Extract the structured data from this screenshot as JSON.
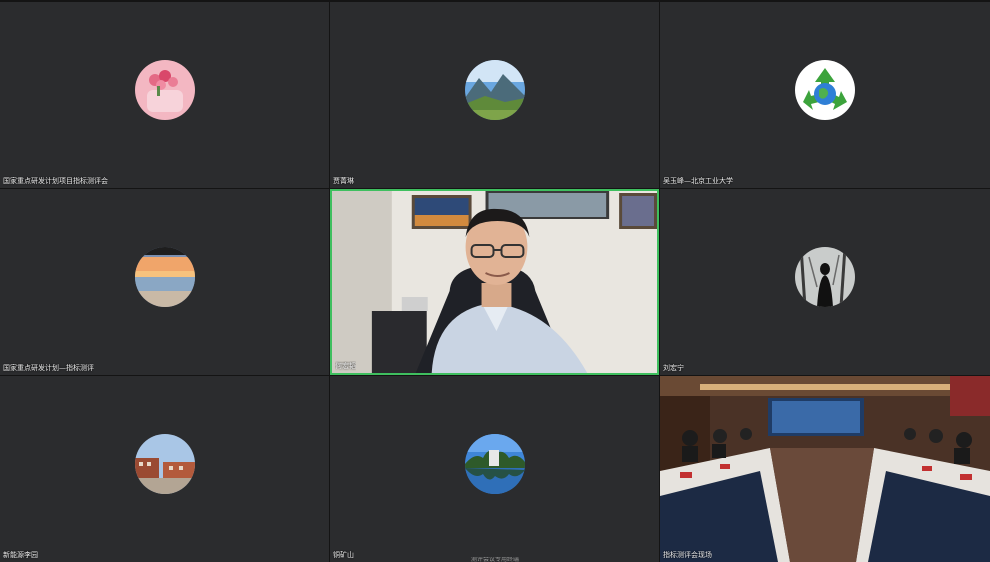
{
  "participants": [
    {
      "name": "国家重点研发计划项目指标测评会",
      "avatar_icon": "rose-flowers-icon"
    },
    {
      "name": "贾菁琳",
      "avatar_icon": "mountain-landscape-icon"
    },
    {
      "name": "吴玉峰—北京工业大学",
      "avatar_icon": "recycle-globe-icon"
    },
    {
      "name": "国家重点研发计划—指标测评",
      "avatar_icon": "sunset-beach-icon"
    },
    {
      "name": "何宏韬",
      "avatar_icon": "presenter-video",
      "active": true
    },
    {
      "name": "刘宏宁",
      "avatar_icon": "silhouette-trees-icon"
    },
    {
      "name": "新能源李园",
      "avatar_icon": "campus-building-icon"
    },
    {
      "name": "铜矿山",
      "avatar_icon": "lake-reflection-icon"
    },
    {
      "name": "指标测评会现场",
      "avatar_icon": "meeting-room-video"
    }
  ],
  "bottom_caption": "测评会议专用终端",
  "colors": {
    "tile_bg": "#2b2c2e",
    "active_border": "#3fbf5f",
    "background": "#141414"
  }
}
